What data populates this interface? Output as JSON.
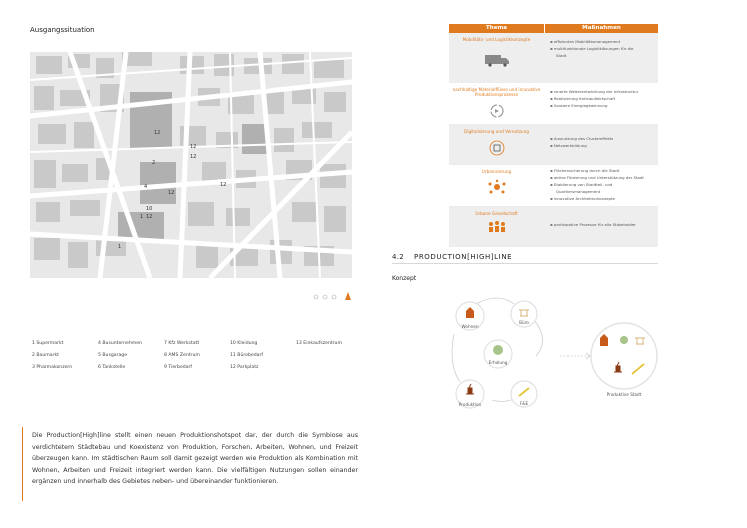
{
  "left": {
    "title": "Ausgangssituation",
    "map_numbers": [
      "12",
      "12",
      "12",
      "2",
      "12",
      "4",
      "12",
      "10",
      "1",
      "12",
      "1"
    ],
    "legend": [
      [
        "1 Supermarkt",
        "4 Busunternehmen",
        "7 Kfz Werkstatt",
        "10 Kleidung",
        "13 Einkaufszentrum"
      ],
      [
        "2 Baumarkt",
        "5 Busgarage",
        "8 AMS Zentrum",
        "11 Bürobedarf",
        ""
      ],
      [
        "3 Pharmakonzern",
        "6 Tankstelle",
        "9 Tierbedarf",
        "12 Parkplatz",
        ""
      ]
    ],
    "paragraph": "Die Production[High]line stellt einen neuen Produktionshotspot dar, der durch die Symbiose aus verdichtetem Städtebau und Koexistenz von Produktion, Forschen, Arbeiten, Wohnen, und Freizeit überzeugen kann. Im städtischen Raum soll damit gezeigt werden wie Produktion als Kombination mit Wohnen, Arbeiten und Freizeit integriert werden kann. Die vielfältigen Nutzungen sollen einander ergänzen und innerhalb des Gebietes neben- und übereinander funktionieren."
  },
  "table": {
    "header": [
      "Thema",
      "Maßnahmen"
    ],
    "rows": [
      {
        "thema": "Mobilitäts- und Logistikkonzepte",
        "icon": "truck-icon",
        "items": [
          "effizientes Mobilitätsmanagement",
          "multifunktionale Logistiklösungen für die",
          "Stadt"
        ]
      },
      {
        "thema": "nachhaltige Materialflüsse und innovative Produktionsprozesse",
        "icon": "recycle-icon",
        "items": [
          "smarte Weiterentwicklung der Infrastruktur",
          "Realisierung Kreislaufwirtschaft",
          "Saubere Energiegewinnung"
        ]
      },
      {
        "thema": "Digitalisierung und Vernetzung",
        "icon": "network-icon",
        "items": [
          "Ausnutzung des Clustereffekts",
          "Netzwerkbildung"
        ]
      },
      {
        "thema": "Urbanisierung",
        "icon": "urban-icon",
        "items": [
          "Flächensicherung durch die Stadt",
          "aktive Förderung und Unterstützung der Stadt",
          "Etablierung von Stadtteil- und",
          "Quartiersmanagement",
          "innovative Architekturkonzepte"
        ]
      },
      {
        "thema": "Urbane Gesellschaft",
        "icon": "people-icon",
        "items": [
          "partizipative Prozesse für alle Stakeholder"
        ]
      }
    ]
  },
  "section": {
    "number": "4.2",
    "title": "PRODUCTION[HIGH]LINE",
    "subtitle": "Konzept"
  },
  "diagram": {
    "nodes": [
      "Wohnen",
      "Büro",
      "Erholung",
      "Produktion",
      "F&E"
    ],
    "result": "Produktive Stadt"
  },
  "colors": {
    "accent": "#e07a1e",
    "shade": "#eeeeee"
  }
}
